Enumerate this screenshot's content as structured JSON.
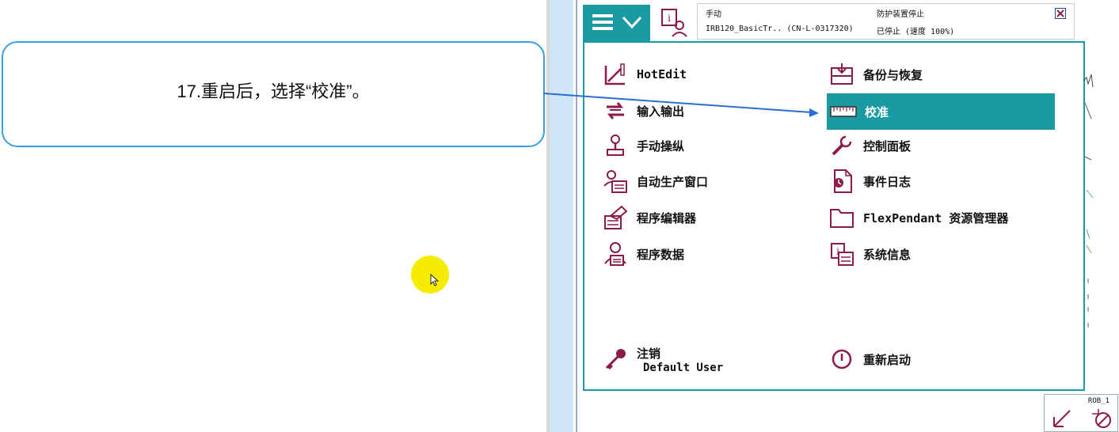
{
  "slide": {
    "callout_text": "17.重启后，选择“校准”。"
  },
  "pendant": {
    "status": {
      "mode": "手动",
      "system": "IRB120_BasicTr.. (CN-L-0317320)",
      "guard": "防护装置停止",
      "state": "已停止 (速度 100%)"
    },
    "menu": {
      "left": [
        {
          "label": "HotEdit",
          "icon": "hotedit-icon"
        },
        {
          "label": "输入输出",
          "icon": "io-icon"
        },
        {
          "label": "手动操纵",
          "icon": "jogging-icon"
        },
        {
          "label": "自动生产窗口",
          "icon": "production-window-icon"
        },
        {
          "label": "程序编辑器",
          "icon": "program-editor-icon"
        },
        {
          "label": "程序数据",
          "icon": "program-data-icon"
        }
      ],
      "right": [
        {
          "label": "备份与恢复",
          "icon": "backup-restore-icon"
        },
        {
          "label": "校准",
          "icon": "calibration-icon",
          "selected": true
        },
        {
          "label": "控制面板",
          "icon": "control-panel-icon"
        },
        {
          "label": "事件日志",
          "icon": "event-log-icon"
        },
        {
          "label": "FlexPendant 资源管理器",
          "icon": "explorer-icon"
        },
        {
          "label": "系统信息",
          "icon": "system-info-icon"
        }
      ],
      "logoff_label": "注销",
      "logoff_user": "Default User",
      "restart_label": "重新启动"
    },
    "rob_label": "ROB_1",
    "colors": {
      "accent": "#1a9aa3",
      "icon": "#8b1a4a",
      "callout_border": "#3aa0db",
      "arrow": "#2a6fd6",
      "halo": "#f5ec00"
    }
  }
}
